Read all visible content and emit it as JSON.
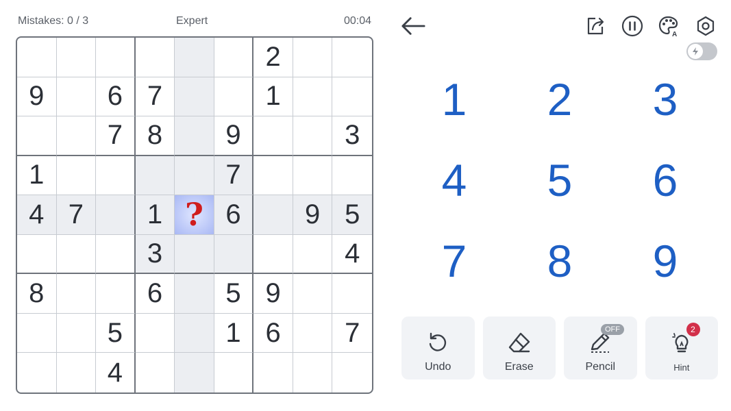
{
  "status": {
    "mistakes": "Mistakes: 0 / 3",
    "difficulty": "Expert",
    "timer": "00:04"
  },
  "board": {
    "rows": [
      [
        "",
        "",
        "",
        "",
        "",
        "",
        "2",
        "",
        ""
      ],
      [
        "9",
        "",
        "6",
        "7",
        "",
        "",
        "1",
        "",
        ""
      ],
      [
        "",
        "",
        "7",
        "8",
        "",
        "9",
        "",
        "",
        "3"
      ],
      [
        "1",
        "",
        "",
        "",
        "",
        "7",
        "",
        "",
        ""
      ],
      [
        "4",
        "7",
        "",
        "1",
        "?",
        "6",
        "",
        "9",
        "5"
      ],
      [
        "",
        "",
        "",
        "3",
        "",
        "",
        "",
        "",
        "4"
      ],
      [
        "8",
        "",
        "",
        "6",
        "",
        "5",
        "9",
        "",
        ""
      ],
      [
        "",
        "",
        "5",
        "",
        "",
        "1",
        "6",
        "",
        "7"
      ],
      [
        "",
        "",
        "4",
        "",
        "",
        "",
        "",
        "",
        ""
      ]
    ],
    "selected": {
      "row": 4,
      "col": 4
    }
  },
  "top_icons": [
    "back-arrow-icon",
    "share-icon",
    "pause-icon",
    "theme-palette-icon",
    "settings-gear-icon"
  ],
  "numpad": [
    "1",
    "2",
    "3",
    "4",
    "5",
    "6",
    "7",
    "8",
    "9"
  ],
  "tools": {
    "undo": {
      "label": "Undo"
    },
    "erase": {
      "label": "Erase"
    },
    "pencil": {
      "label": "Pencil",
      "badge": "OFF"
    },
    "hint": {
      "label": "Hint",
      "badge": "2"
    }
  },
  "colors": {
    "number_blue": "#1e5fc4",
    "mistake_red": "#d01c1c",
    "highlight": "#eceef2",
    "badge_red": "#d2304a"
  }
}
